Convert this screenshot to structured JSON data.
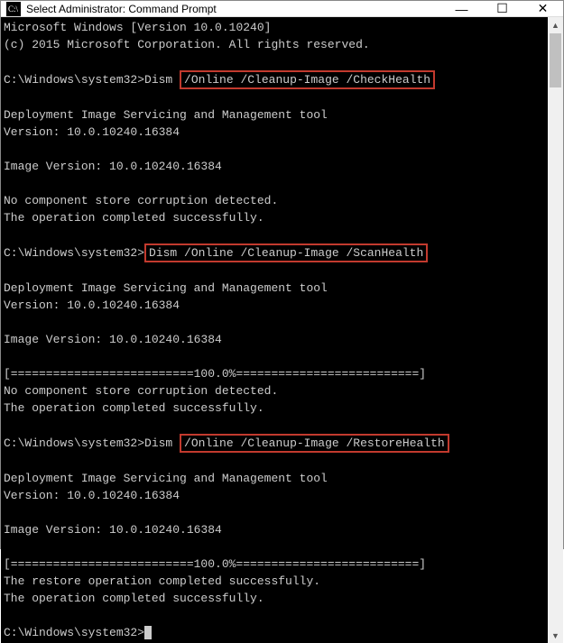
{
  "window": {
    "title": "Select Administrator: Command Prompt",
    "controls": {
      "minimize": "—",
      "maximize": "☐",
      "close": "✕"
    }
  },
  "terminal": {
    "os_line": "Microsoft Windows [Version 10.0.10240]",
    "copyright": "(c) 2015 Microsoft Corporation. All rights reserved.",
    "prompt": "C:\\Windows\\system32>",
    "cmd1_prefix": "Dism ",
    "cmd1_highlight": "/Online /Cleanup-Image /CheckHealth",
    "tool_line": "Deployment Image Servicing and Management tool",
    "version_line": "Version: 10.0.10240.16384",
    "image_version": "Image Version: 10.0.10240.16384",
    "no_corruption": "No component store corruption detected.",
    "completed": "The operation completed successfully.",
    "cmd2_highlight": "Dism /Online /Cleanup-Image /ScanHealth",
    "progress": "[==========================100.0%==========================]",
    "cmd3_prefix": "Dism ",
    "cmd3_highlight": "/Online /Cleanup-Image /RestoreHealth",
    "restore_done": "The restore operation completed successfully."
  }
}
